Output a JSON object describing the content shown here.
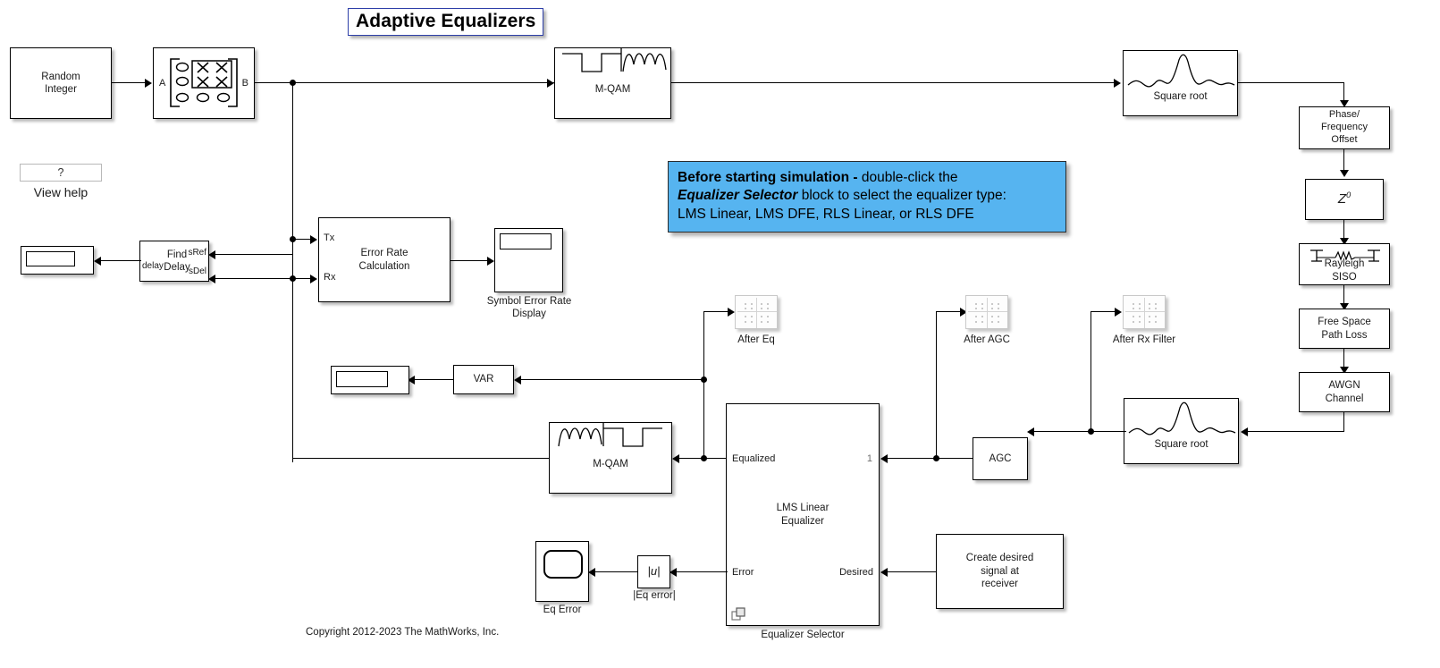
{
  "title": {
    "text": "Adaptive Equalizers",
    "accent": "#2e3fa8"
  },
  "annotation": {
    "line1_bold": "Before starting simulation - ",
    "line1_rest": "double-click the",
    "line2_bolditalic": "Equalizer Selector",
    "line2_rest": " block to select the equalizer type:",
    "line3": "LMS Linear, LMS DFE, RLS Linear, or RLS DFE",
    "bg": "#56b4f0"
  },
  "help": {
    "glyph": "?",
    "caption": "View help"
  },
  "copyright": "Copyright 2012-2023 The MathWorks, Inc.",
  "blocks": {
    "random_integer": {
      "label": "Random\nInteger"
    },
    "matrix_select": {
      "port_in": "A",
      "port_out": "B"
    },
    "mqam_mod": {
      "label": "M-QAM"
    },
    "tx_filter": {
      "label": "Square root"
    },
    "phase_freq_offset": {
      "label": "Phase/\nFrequency\nOffset"
    },
    "delay_z0": {
      "label_base": "Z",
      "label_exp": "0"
    },
    "rayleigh": {
      "label": "Rayleigh\nSISO"
    },
    "path_loss": {
      "label": "Free Space\nPath Loss"
    },
    "awgn": {
      "label": "AWGN\nChannel"
    },
    "rx_filter": {
      "label": "Square root"
    },
    "agc": {
      "label": "AGC"
    },
    "equalizer_selector": {
      "label": "LMS Linear\nEqualizer",
      "caption": "Equalizer Selector",
      "port_equalized": "Equalized",
      "port_error": "Error",
      "port_1": "1",
      "port_desired": "Desired"
    },
    "create_desired": {
      "label": "Create desired\nsignal at\nreceiver"
    },
    "mqam_demod": {
      "label": "M-QAM"
    },
    "abs_eq_error": {
      "label": "|u|",
      "caption": "|Eq error|"
    },
    "eq_error_scope": {
      "caption": "Eq Error"
    },
    "var_block": {
      "label": "VAR"
    },
    "var_display": {
      "label": ""
    },
    "error_rate": {
      "label": "Error Rate\nCalculation",
      "port_tx": "Tx",
      "port_rx": "Rx"
    },
    "ser_display": {
      "caption": "Symbol Error Rate\nDisplay"
    },
    "find_delay": {
      "label": "Find\nDelay",
      "port_delay": "delay",
      "port_sref": "sRef",
      "port_sdel": "sDel"
    },
    "delay_display": {
      "label": ""
    }
  },
  "scopes": {
    "after_eq": {
      "caption": "After Eq"
    },
    "after_agc": {
      "caption": "After AGC"
    },
    "after_rx_filter": {
      "caption": "After Rx Filter"
    }
  }
}
